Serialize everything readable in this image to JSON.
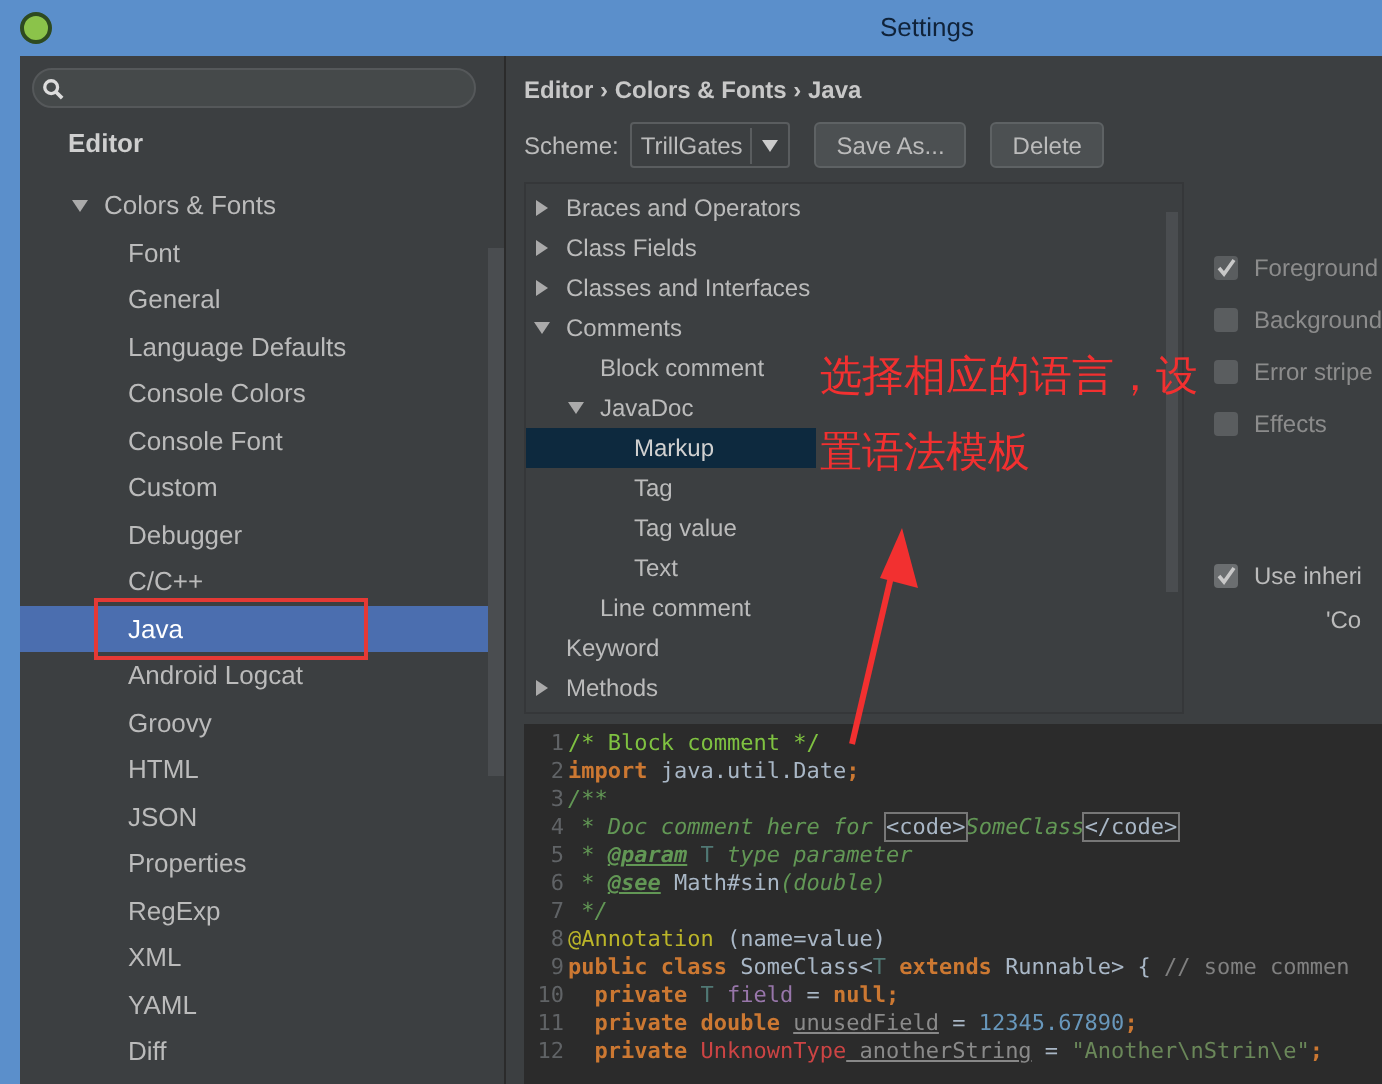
{
  "window": {
    "title": "Settings"
  },
  "sidebar": {
    "heading": "Editor",
    "items": [
      {
        "label": "Colors & Fonts",
        "expanded": true,
        "selected": false,
        "children": [
          {
            "label": "Font",
            "selected": false
          },
          {
            "label": "General",
            "selected": false
          },
          {
            "label": "Language Defaults",
            "selected": false
          },
          {
            "label": "Console Colors",
            "selected": false
          },
          {
            "label": "Console Font",
            "selected": false
          },
          {
            "label": "Custom",
            "selected": false
          },
          {
            "label": "Debugger",
            "selected": false
          },
          {
            "label": "C/C++",
            "selected": false
          },
          {
            "label": "Java",
            "selected": true
          },
          {
            "label": "Android Logcat",
            "selected": false
          },
          {
            "label": "Groovy",
            "selected": false
          },
          {
            "label": "HTML",
            "selected": false
          },
          {
            "label": "JSON",
            "selected": false
          },
          {
            "label": "Properties",
            "selected": false
          },
          {
            "label": "RegExp",
            "selected": false
          },
          {
            "label": "XML",
            "selected": false
          },
          {
            "label": "YAML",
            "selected": false
          },
          {
            "label": "Diff",
            "selected": false
          }
        ]
      }
    ]
  },
  "breadcrumb": "Editor › Colors & Fonts › Java",
  "scheme": {
    "label": "Scheme:",
    "value": "TrillGates",
    "buttons": [
      "Save As...",
      "Delete"
    ]
  },
  "attributes": [
    {
      "label": "Braces and Operators",
      "expanded": false,
      "selected": false
    },
    {
      "label": "Class Fields",
      "expanded": false,
      "selected": false
    },
    {
      "label": "Classes and Interfaces",
      "expanded": false,
      "selected": false
    },
    {
      "label": "Comments",
      "expanded": true,
      "selected": false,
      "children": [
        {
          "label": "Block comment",
          "selected": false
        },
        {
          "label": "JavaDoc",
          "expanded": true,
          "selected": false,
          "children": [
            {
              "label": "Markup",
              "selected": true
            },
            {
              "label": "Tag",
              "selected": false
            },
            {
              "label": "Tag value",
              "selected": false
            },
            {
              "label": "Text",
              "selected": false
            }
          ]
        },
        {
          "label": "Line comment",
          "selected": false
        }
      ]
    },
    {
      "label": "Keyword",
      "selected": false
    },
    {
      "label": "Methods",
      "expanded": false,
      "selected": false
    }
  ],
  "options": [
    {
      "label": "Foreground",
      "checked": true
    },
    {
      "label": "Background",
      "checked": false
    },
    {
      "label": "Error stripe",
      "checked": false
    },
    {
      "label": "Effects",
      "checked": false
    }
  ],
  "inherit": {
    "label": "Use inheri",
    "checked": true,
    "note": "'Co"
  },
  "code": [
    {
      "number": "1",
      "tokens": [
        {
          "text": "/* Block comment */",
          "kind": "comment"
        }
      ]
    },
    {
      "number": "2",
      "tokens": [
        {
          "text": "import ",
          "kind": "keyword"
        },
        {
          "text": "java.util.Date",
          "kind": "plain"
        },
        {
          "text": ";",
          "kind": "keyword"
        }
      ]
    },
    {
      "number": "3",
      "tokens": [
        {
          "text": "/**",
          "kind": "doc"
        }
      ]
    },
    {
      "number": "4",
      "tokens": [
        {
          "text": " * Doc comment here for ",
          "kind": "doc"
        },
        {
          "text": "<code>",
          "kind": "markup"
        },
        {
          "text": "SomeClass",
          "kind": "doc"
        },
        {
          "text": "</code>",
          "kind": "markup"
        }
      ]
    },
    {
      "number": "5",
      "tokens": [
        {
          "text": " * ",
          "kind": "doc"
        },
        {
          "text": "@param",
          "kind": "doctag"
        },
        {
          "text": " T",
          "kind": "typeparam"
        },
        {
          "text": " type parameter",
          "kind": "doc"
        }
      ]
    },
    {
      "number": "6",
      "tokens": [
        {
          "text": " * ",
          "kind": "doc"
        },
        {
          "text": "@see",
          "kind": "doctag"
        },
        {
          "text": " Math#sin",
          "kind": "plain"
        },
        {
          "text": "(double)",
          "kind": "doc"
        }
      ]
    },
    {
      "number": "7",
      "tokens": [
        {
          "text": " */",
          "kind": "doc"
        }
      ]
    },
    {
      "number": "8",
      "tokens": [
        {
          "text": "@Annotation",
          "kind": "annotation"
        },
        {
          "text": " (name=value)",
          "kind": "plain"
        }
      ]
    },
    {
      "number": "9",
      "tokens": [
        {
          "text": "public class ",
          "kind": "keyword"
        },
        {
          "text": "SomeClass<",
          "kind": "plain"
        },
        {
          "text": "T",
          "kind": "typeparam"
        },
        {
          "text": " extends ",
          "kind": "keyword"
        },
        {
          "text": "Runnable> { ",
          "kind": "plain"
        },
        {
          "text": "// some commen",
          "kind": "linecomment"
        }
      ]
    },
    {
      "number": "10",
      "tokens": [
        {
          "text": "  private ",
          "kind": "keyword"
        },
        {
          "text": "T",
          "kind": "typeparam"
        },
        {
          "text": " field",
          "kind": "field"
        },
        {
          "text": " = ",
          "kind": "plain"
        },
        {
          "text": "null;",
          "kind": "keyword"
        }
      ]
    },
    {
      "number": "11",
      "tokens": [
        {
          "text": "  private double ",
          "kind": "keyword"
        },
        {
          "text": "unusedField",
          "kind": "unused"
        },
        {
          "text": " = ",
          "kind": "plain"
        },
        {
          "text": "12345.67890",
          "kind": "number"
        },
        {
          "text": ";",
          "kind": "keyword"
        }
      ]
    },
    {
      "number": "12",
      "tokens": [
        {
          "text": "  private ",
          "kind": "keyword"
        },
        {
          "text": "UnknownType",
          "kind": "unknown"
        },
        {
          "text": " anotherString",
          "kind": "unused"
        },
        {
          "text": " = ",
          "kind": "plain"
        },
        {
          "text": "\"Another\\nStrin\\e\"",
          "kind": "string"
        },
        {
          "text": ";",
          "kind": "keyword"
        }
      ]
    }
  ],
  "annotation": {
    "lines": [
      "选择相应的语言，设",
      "置语法模板"
    ]
  }
}
